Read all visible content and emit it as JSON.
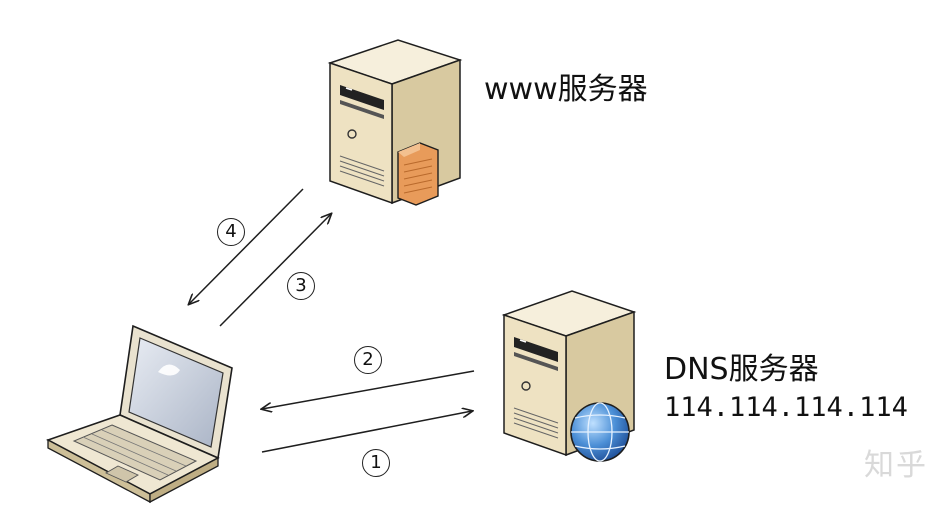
{
  "diagram": {
    "nodes": {
      "www_server": {
        "label": "www服务器"
      },
      "dns_server": {
        "label": "DNS服务器",
        "ip": "114.114.114.114"
      },
      "client": {
        "label": ""
      }
    },
    "steps": [
      {
        "number": "④",
        "from": "www_server",
        "to": "client"
      },
      {
        "number": "③",
        "from": "client",
        "to": "www_server"
      },
      {
        "number": "②",
        "from": "dns_server",
        "to": "client"
      },
      {
        "number": "①",
        "from": "client",
        "to": "dns_server"
      }
    ],
    "watermark": "知乎"
  },
  "colors": {
    "server_body": "#efe5c9",
    "server_shadow": "#c9b98e",
    "outline": "#1e1e1e",
    "globe": "#3f7fc8",
    "orange_panel": "#e89b5a",
    "laptop_screen": "#c5ccd9"
  }
}
